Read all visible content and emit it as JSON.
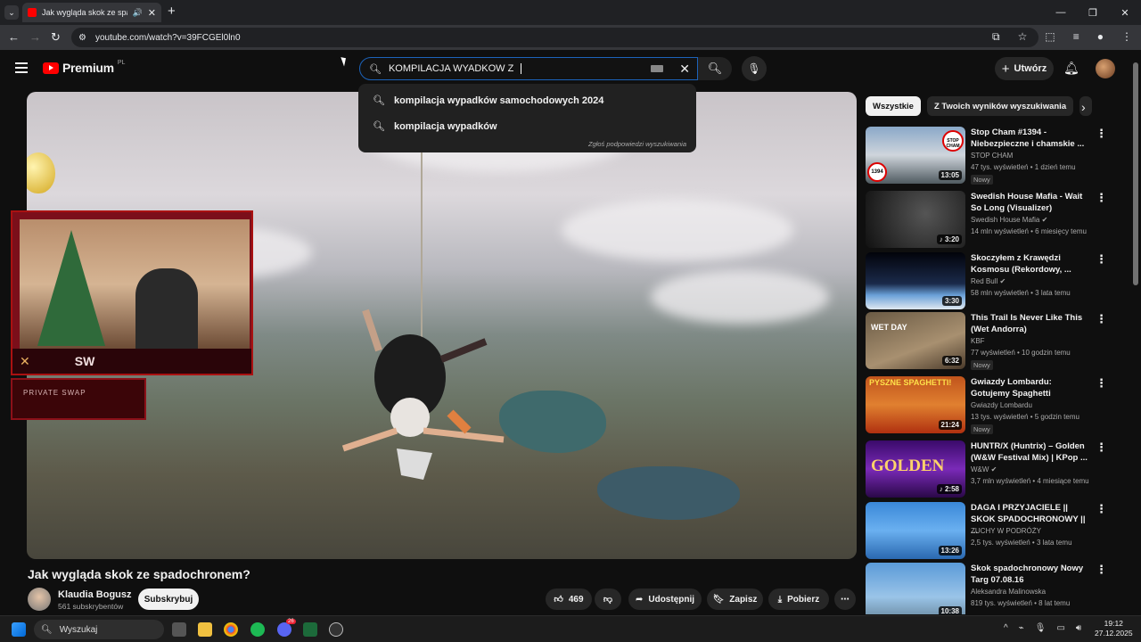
{
  "browser": {
    "tab_title": "Jak wygląda skok ze spadoc",
    "url": "youtube.com/watch?v=39FCGEl0ln0"
  },
  "header": {
    "logo_text": "Premium",
    "logo_region": "PL",
    "search_value": "KOMPILACJA WYADKOW Z",
    "create_label": "Utwórz"
  },
  "suggestions": {
    "items": [
      "kompilacja wypadków samochodowych 2024",
      "kompilacja wypadków"
    ],
    "report": "Zgłoś podpowiedzi wyszukiwania"
  },
  "video": {
    "title": "Jak wygląda skok ze spadochronem?",
    "channel": "Klaudia Bogusz",
    "subscribers": "561 subskrybentów",
    "subscribe_label": "Subskrybuj",
    "likes": "469",
    "share_label": "Udostępnij",
    "save_label": "Zapisz",
    "download_label": "Pobierz"
  },
  "chips": [
    "Wszystkie",
    "Z Twoich wyników wyszukiwania"
  ],
  "recommendations": [
    {
      "title": "Stop Cham #1394 - Niebezpieczne i chamskie ...",
      "channel": "STOP CHAM",
      "meta": "47 tys. wyświetleń • 1 dzień temu",
      "duration": "13:05",
      "badge": "Nowy"
    },
    {
      "title": "Swedish House Mafia - Wait So Long (Visualizer)",
      "channel": "Swedish House Mafia",
      "meta": "14 mln wyświetleń • 6 miesięcy temu",
      "duration": "3:20",
      "badge": ""
    },
    {
      "title": "Skoczyłem z Krawędzi Kosmosu (Rekordowy, ...",
      "channel": "Red Bull",
      "meta": "58 mln wyświetleń • 3 lata temu",
      "duration": "3:30",
      "badge": ""
    },
    {
      "title": "This Trail Is Never Like This (Wet Andorra)",
      "channel": "KBF",
      "meta": "77 wyświetleń • 10 godzin temu",
      "duration": "6:32",
      "badge": "Nowy"
    },
    {
      "title": "Gwiazdy Lombardu: Gotujemy Spaghetti",
      "channel": "Gwiazdy Lombardu",
      "meta": "13 tys. wyświetleń • 5 godzin temu",
      "duration": "21:24",
      "badge": "Nowy"
    },
    {
      "title": "HUNTR/X (Huntrix) – Golden (W&W Festival Mix) | KPop ...",
      "channel": "W&W",
      "meta": "3,7 mln wyświetleń • 4 miesiące temu",
      "duration": "2:58",
      "badge": ""
    },
    {
      "title": "DAGA I PRZYJACIELE || SKOK SPADOCHRONOWY || ...",
      "channel": "ZUCHY W PODRÓŻY",
      "meta": "2,5 tys. wyświetleń • 3 lata temu",
      "duration": "13:26",
      "badge": ""
    },
    {
      "title": "Skok spadochronowy Nowy Targ 07.08.16",
      "channel": "Aleksandra Malinowska",
      "meta": "819 tys. wyświetleń • 8 lat temu",
      "duration": "10:38",
      "badge": ""
    }
  ],
  "thumb_texts": {
    "stop": "STOP CHAM",
    "ep": "1394",
    "wetday": "WET DAY",
    "pyszne": "PYSZNE SPAGHETTI!",
    "golden": "GOLDEN"
  },
  "overlay": {
    "banner": "PRIVATE SWAP"
  },
  "taskbar": {
    "search_label": "Wyszukaj",
    "time": "19:12",
    "date": "27.12.2025",
    "discord_badge": "26"
  }
}
